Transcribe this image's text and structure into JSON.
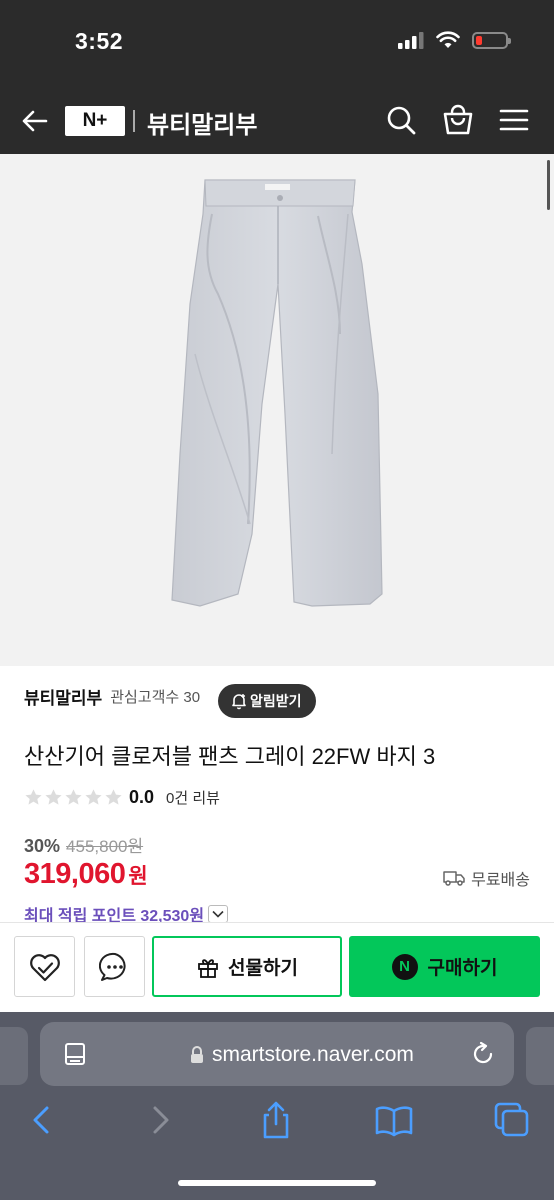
{
  "status_bar": {
    "time": "3:52"
  },
  "header": {
    "logo_text": "N+",
    "store_title": "뷰티말리부"
  },
  "product": {
    "seller_name": "뷰티말리부",
    "followers": "관심고객수 30",
    "alarm_label": "알림받기",
    "title": "산산기어 클로저블 팬츠 그레이 22FW 바지 3",
    "rating": "0.0",
    "rating_stars": 0,
    "review_count": "0건 리뷰",
    "discount_rate": "30%",
    "original_price": "455,800원",
    "sale_price": "319,060",
    "currency": "원",
    "shipping": "무료배송",
    "points": "최대 적립 포인트 32,530원"
  },
  "actions": {
    "gift_label": "선물하기",
    "buy_label": "구매하기",
    "npay_letter": "N"
  },
  "browser": {
    "url": "smartstore.naver.com"
  },
  "colors": {
    "accent_green": "#03c75a",
    "price_red": "#e0152e",
    "points_purple": "#6b4fbb",
    "header_dark": "#2b2b2b"
  }
}
